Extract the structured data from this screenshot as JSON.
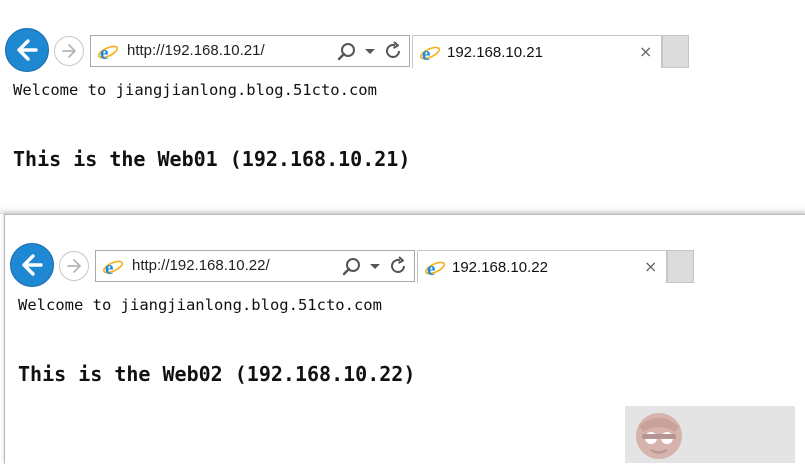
{
  "windows": [
    {
      "address": {
        "url": "http://192.168.10.21/"
      },
      "tab": {
        "title": "192.168.10.21",
        "close": "×"
      },
      "page": {
        "welcome": "Welcome to jiangjianlong.blog.51cto.com",
        "heading": "This is the Web01 (192.168.10.21)"
      }
    },
    {
      "address": {
        "url": "http://192.168.10.22/"
      },
      "tab": {
        "title": "192.168.10.22",
        "close": "×"
      },
      "page": {
        "welcome": "Welcome to jiangjianlong.blog.51cto.com",
        "heading": "This is the Web02 (192.168.10.22)"
      }
    }
  ],
  "icons": {
    "back": "back-arrow-icon",
    "forward": "forward-arrow-icon",
    "browser": "internet-explorer-icon",
    "search": "search-icon",
    "dropdown": "dropdown-icon",
    "refresh": "refresh-icon",
    "close": "close-tab-icon",
    "watermark": "monkey-logo-icon"
  },
  "colors": {
    "back_button": "#1e88d3",
    "ie_logo": "#1c8ad8",
    "ie_ring": "#f3b01b"
  }
}
